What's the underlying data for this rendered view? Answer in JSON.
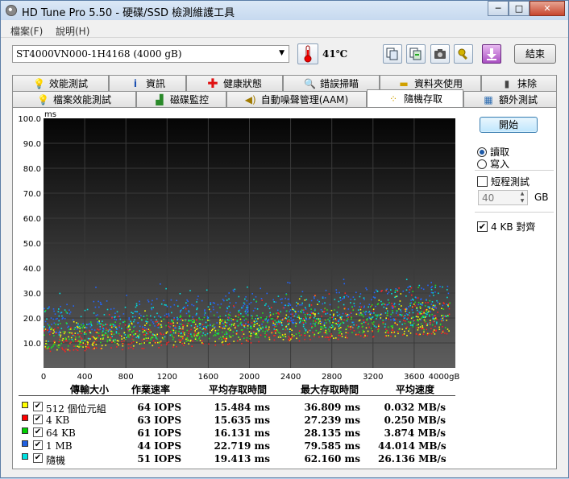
{
  "window": {
    "title": "HD Tune Pro 5.50 - 硬碟/SSD 檢測維護工具",
    "minimize": "─",
    "maximize": "□",
    "close": "✕"
  },
  "menu": [
    "檔案(F)",
    "說明(H)"
  ],
  "toolbar": {
    "drive": "ST4000VN000-1H4168 (4000 gB)",
    "temperature": "41℃",
    "exit_label": "結束",
    "icons": [
      "copy-info-icon",
      "copy-results-icon",
      "screenshot-camera-icon",
      "options-tool-icon",
      "save-download-icon"
    ]
  },
  "tabs_top": [
    {
      "label": "效能測試",
      "icon": "benchmark-bulb-icon"
    },
    {
      "label": "資訊",
      "icon": "info-icon"
    },
    {
      "label": "健康狀態",
      "icon": "health-cross-icon"
    },
    {
      "label": "錯誤掃瞄",
      "icon": "error-scan-magnifier-icon"
    },
    {
      "label": "資料夾使用",
      "icon": "folder-icon"
    },
    {
      "label": "抹除",
      "icon": "erase-trash-icon"
    }
  ],
  "tabs_bottom": [
    {
      "label": "檔案效能測試",
      "icon": "file-benchmark-icon"
    },
    {
      "label": "磁碟監控",
      "icon": "disk-monitor-icon"
    },
    {
      "label": "自動噪聲管理(AAM)",
      "icon": "speaker-icon"
    },
    {
      "label": "隨機存取",
      "icon": "random-access-icon",
      "active": true
    },
    {
      "label": "額外測試",
      "icon": "extra-tests-icon"
    }
  ],
  "controls": {
    "start_label": "開始",
    "read_label": "讀取",
    "write_label": "寫入",
    "mode": "read",
    "short_test_label": "短程測試",
    "short_test_checked": false,
    "short_test_value": "40",
    "short_test_unit": "GB",
    "align_label": "4 KB 對齊",
    "align_checked": true
  },
  "chart_data": {
    "type": "scatter",
    "ylabel": "ms",
    "xlabel_unit": "gB",
    "xlim": [
      0,
      4000
    ],
    "ylim": [
      0,
      100
    ],
    "x_ticks": [
      "0",
      "400",
      "800",
      "1200",
      "1600",
      "2000",
      "2400",
      "2800",
      "3200",
      "3600",
      "4000gB"
    ],
    "y_ticks": [
      "10.0",
      "20.0",
      "30.0",
      "40.0",
      "50.0",
      "60.0",
      "70.0",
      "80.0",
      "90.0",
      "100.0"
    ],
    "grid": true,
    "series": [
      {
        "name": "512 個位元組",
        "color": "#ffff00",
        "access_ms_start": [
          7,
          16
        ],
        "access_ms_end": [
          14,
          27
        ]
      },
      {
        "name": "4 KB",
        "color": "#ff2020",
        "access_ms_start": [
          6,
          16
        ],
        "access_ms_end": [
          14,
          28
        ]
      },
      {
        "name": "64 KB",
        "color": "#20e020",
        "access_ms_start": [
          8,
          18
        ],
        "access_ms_end": [
          16,
          28
        ]
      },
      {
        "name": "1 MB",
        "color": "#2266ff",
        "access_ms_start": [
          14,
          26
        ],
        "access_ms_end": [
          20,
          34
        ]
      },
      {
        "name": "隨機",
        "color": "#00e0e0",
        "access_ms_start": [
          10,
          24
        ],
        "access_ms_end": [
          18,
          33
        ]
      }
    ]
  },
  "results": {
    "headers": [
      "傳輸大小",
      "作業速率",
      "平均存取時間",
      "最大存取時間",
      "平均速度"
    ],
    "rows": [
      {
        "size": "512 個位元組",
        "color": "#ffff00",
        "checked": true,
        "iops": "64 IOPS",
        "avg": "15.484 ms",
        "max": "36.809 ms",
        "speed": "0.032 MB/s"
      },
      {
        "size": "4 KB",
        "color": "#ff0000",
        "checked": true,
        "iops": "63 IOPS",
        "avg": "15.635 ms",
        "max": "27.239 ms",
        "speed": "0.250 MB/s"
      },
      {
        "size": "64 KB",
        "color": "#00d000",
        "checked": true,
        "iops": "61 IOPS",
        "avg": "16.131 ms",
        "max": "28.135 ms",
        "speed": "3.874 MB/s"
      },
      {
        "size": "1 MB",
        "color": "#2060e0",
        "checked": true,
        "iops": "44 IOPS",
        "avg": "22.719 ms",
        "max": "79.585 ms",
        "speed": "44.014 MB/s"
      },
      {
        "size": "隨機",
        "color": "#00e0e0",
        "checked": true,
        "iops": "51 IOPS",
        "avg": "19.413 ms",
        "max": "62.160 ms",
        "speed": "26.136 MB/s"
      }
    ]
  }
}
